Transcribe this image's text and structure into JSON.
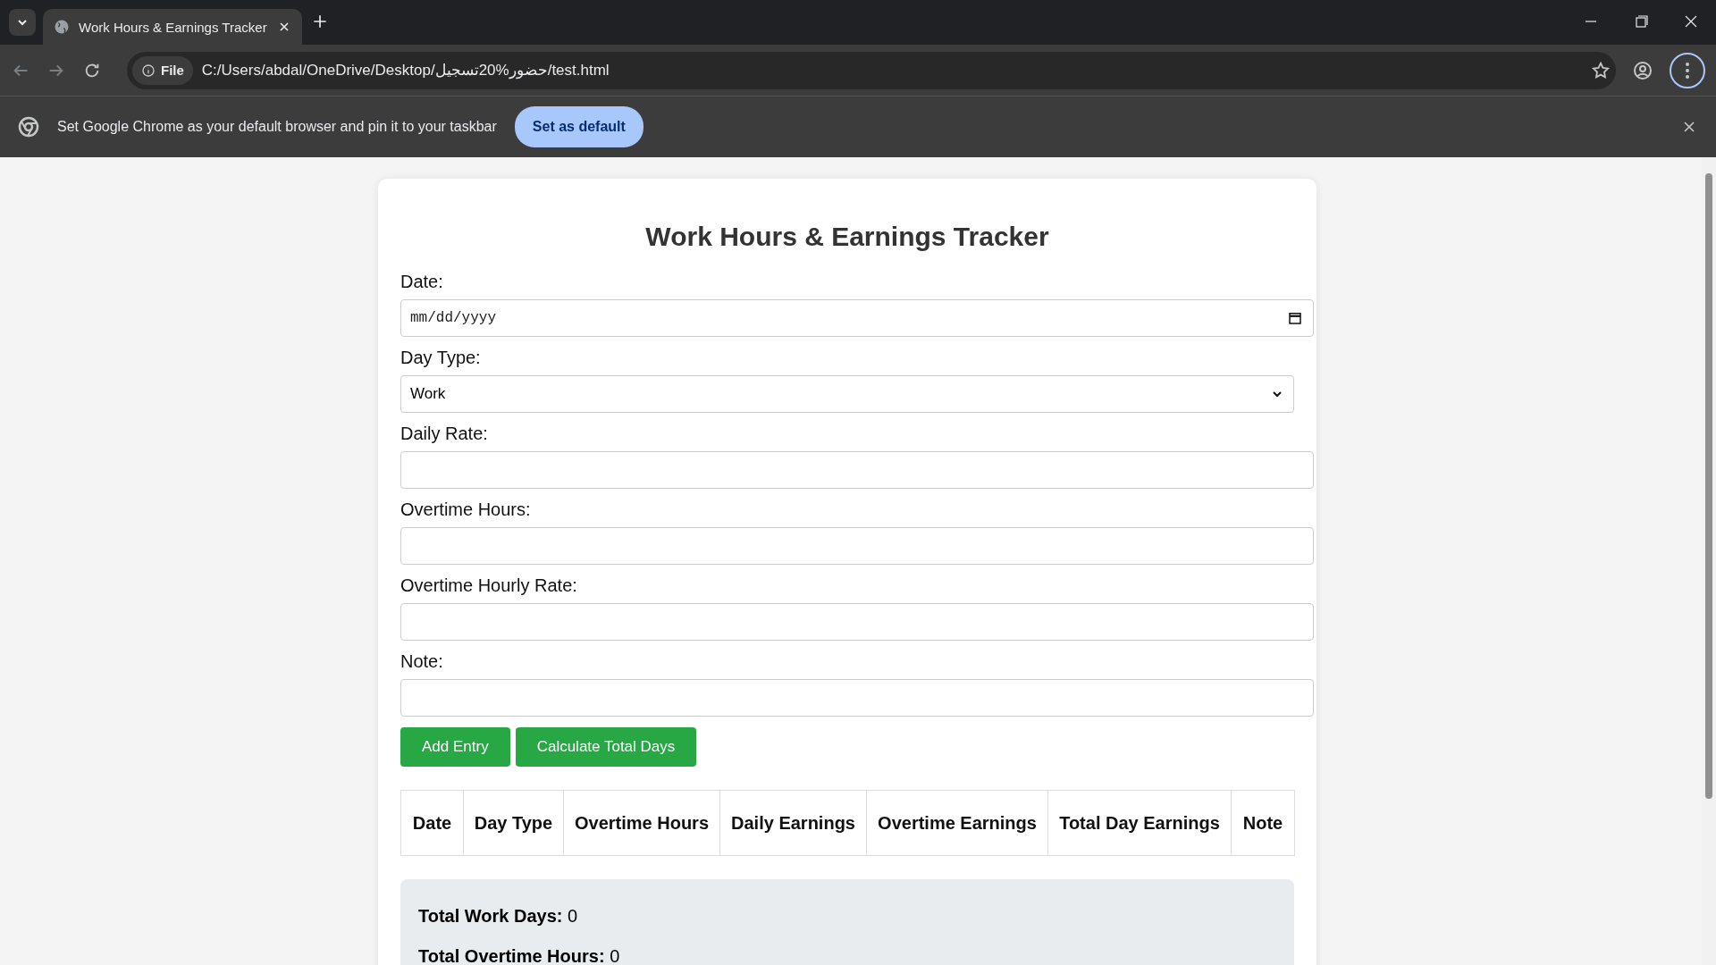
{
  "browser": {
    "tabs": [
      {
        "title": "Work Hours & Earnings Tracker",
        "selected": true
      }
    ],
    "address": {
      "scheme": "File",
      "url": "C:/Users/abdal/OneDrive/Desktop/حضور%20تسجيل/test.html"
    },
    "infobar": {
      "message": "Set Google Chrome as your default browser and pin it to your taskbar",
      "button": "Set as default"
    }
  },
  "page": {
    "title": "Work Hours & Earnings Tracker",
    "fields": [
      {
        "label": "Date:",
        "kind": "date",
        "placeholder": "mm/dd/yyyy"
      },
      {
        "label": "Day Type:",
        "kind": "select",
        "value": "Work"
      },
      {
        "label": "Daily Rate:",
        "kind": "text"
      },
      {
        "label": "Overtime Hours:",
        "kind": "text"
      },
      {
        "label": "Overtime Hourly Rate:",
        "kind": "text"
      },
      {
        "label": "Note:",
        "kind": "text"
      }
    ],
    "buttons": [
      "Add Entry",
      "Calculate Total Days"
    ],
    "table": {
      "columns": [
        "Date",
        "Day Type",
        "Overtime Hours",
        "Daily Earnings",
        "Overtime Earnings",
        "Total Day Earnings",
        "Note"
      ]
    },
    "summary": [
      {
        "label": "Total Work Days:",
        "value": "0"
      },
      {
        "label": "Total Overtime Hours:",
        "value": "0"
      }
    ]
  }
}
